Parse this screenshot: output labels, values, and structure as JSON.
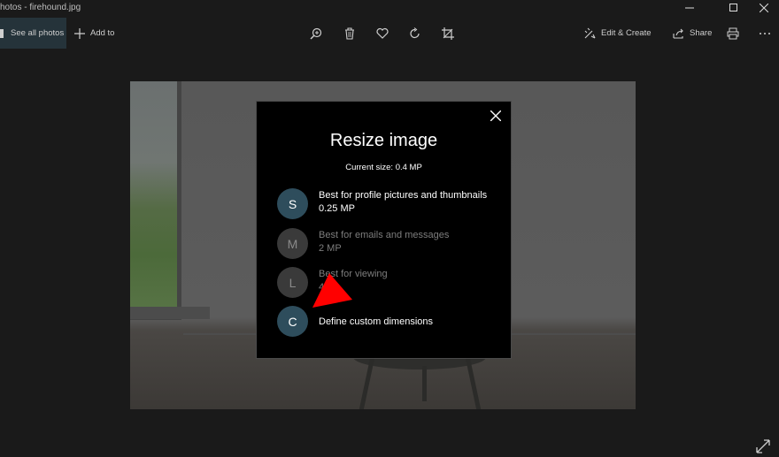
{
  "window": {
    "title": "hotos - firehound.jpg",
    "minimize_icon": "minimize-icon",
    "maximize_icon": "maximize-icon",
    "close_icon": "close-icon"
  },
  "toolbar": {
    "see_all_photos": "See all photos",
    "add_to": "Add to",
    "edit_create": "Edit & Create",
    "share": "Share",
    "icons": [
      "zoom-in-icon",
      "delete-icon",
      "favorite-icon",
      "rotate-icon",
      "crop-icon",
      "print-icon",
      "more-icon"
    ]
  },
  "dialog": {
    "title": "Resize image",
    "current_size": "Current size: 0.4 MP",
    "options": [
      {
        "letter": "S",
        "label": "Best for profile pictures and thumbnails",
        "size": "0.25 MP",
        "enabled": true
      },
      {
        "letter": "M",
        "label": "Best for emails and messages",
        "size": "2 MP",
        "enabled": false
      },
      {
        "letter": "L",
        "label": "Best for viewing",
        "size": "4",
        "enabled": false
      },
      {
        "letter": "C",
        "label": "Define custom dimensions",
        "size": "",
        "enabled": true
      }
    ]
  },
  "colors": {
    "background": "#1a1a1a",
    "dialog_bg": "#000000",
    "avatar_active": "#2e4d5c",
    "avatar_disabled": "#3a3a3a",
    "cursor": "#ff0000"
  }
}
